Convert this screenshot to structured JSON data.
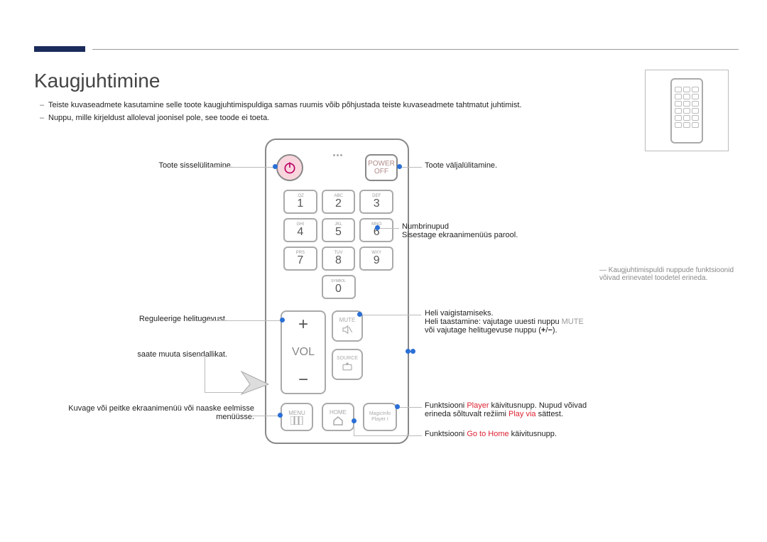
{
  "title": "Kaugjuhtimine",
  "bullets": [
    "Teiste kuvaseadmete kasutamine selle toote kaugjuhtimispuldiga samas ruumis võib põhjustada teiste kuvaseadmete tahtmatut juhtimist.",
    "Nuppu, mille kirjeldust alloleval joonisel pole, see toode ei toeta."
  ],
  "remote": {
    "power_off": "POWER OFF",
    "keys": [
      {
        "lbl": ".QZ",
        "num": "1"
      },
      {
        "lbl": "ABC",
        "num": "2"
      },
      {
        "lbl": "DEF",
        "num": "3"
      },
      {
        "lbl": "GHI",
        "num": "4"
      },
      {
        "lbl": "JKL",
        "num": "5"
      },
      {
        "lbl": "MNO",
        "num": "6"
      },
      {
        "lbl": "PRS",
        "num": "7"
      },
      {
        "lbl": "TUV",
        "num": "8"
      },
      {
        "lbl": "WXY",
        "num": "9"
      }
    ],
    "sym_lbl": "SYMBOL",
    "zero": "0",
    "vol": "VOL",
    "mute": "MUTE",
    "source": "SOURCE",
    "menu": "MENU",
    "home": "HOME",
    "magic_l1": "MagicInfo",
    "magic_l2": "Player I"
  },
  "left": {
    "power_on": "Toote sisselülitamine.",
    "volume": "Reguleerige helitugevust.",
    "source": "saate muuta sisendallikat.",
    "menu": "Kuvage või peitke ekraanimenüü või naaske eelmisse menüüsse."
  },
  "right": {
    "power_off": "Toote väljalülitamine.",
    "number_l1": "Numbrinupud",
    "number_l2": "Sisestage ekraanimenüüs parool.",
    "mute_l1": "Heli vaigistamiseks.",
    "mute_l2a": "Heli taastamine: vajutage uuesti nuppu ",
    "mute_l2b": "MUTE",
    "mute_l3a": "või vajutage helitugevuse nuppu (",
    "mute_l3b": ").",
    "player_a": "Funktsiooni ",
    "player_red": "Player",
    "player_b": " käivitusnupp. Nupud võivad",
    "player_l2a": "erineda sõltuvalt režiimi ",
    "player_l2_red": "Play via",
    "player_l2b": " sättest.",
    "home_a": "Funktsiooni ",
    "home_red": "Go to Home",
    "home_b": " käivitusnupp."
  },
  "sidenote": "Kaugjuhtimispuldi nuppude funktsioonid võivad erinevatel toodetel erineda."
}
